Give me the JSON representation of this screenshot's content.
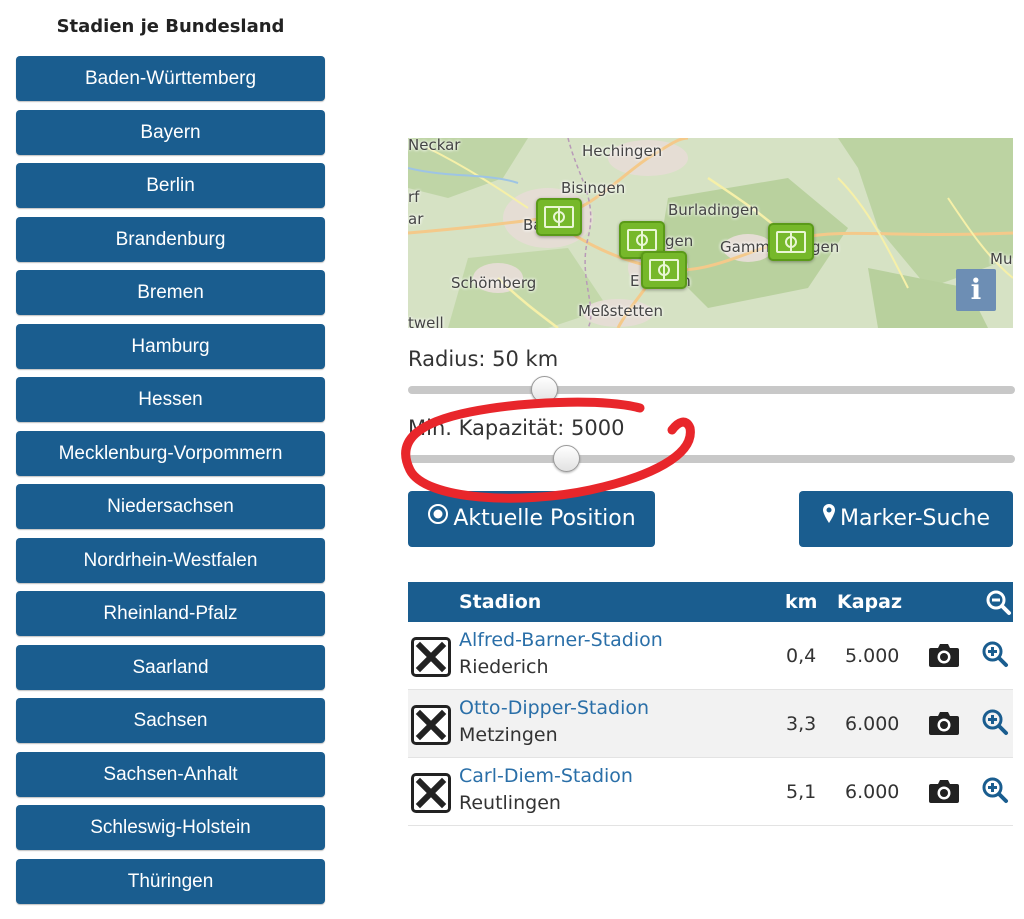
{
  "sidebar": {
    "title": "Stadien je Bundesland",
    "states": [
      "Baden-Württemberg",
      "Bayern",
      "Berlin",
      "Brandenburg",
      "Bremen",
      "Hamburg",
      "Hessen",
      "Mecklenburg-Vorpommern",
      "Niedersachsen",
      "Nordrhein-Westfalen",
      "Rheinland-Pfalz",
      "Saarland",
      "Sachsen",
      "Sachsen-Anhalt",
      "Schleswig-Holstein",
      "Thüringen"
    ]
  },
  "map": {
    "places": [
      "Neckar",
      "Hechingen",
      "Bisingen",
      "Burladingen",
      "Gamm",
      "gen",
      "Schömberg",
      "Meßstetten",
      "Bal",
      "gen",
      "E",
      "en",
      "twell",
      "rf",
      "ar",
      "Mu"
    ],
    "markers": 4,
    "info_label": "i"
  },
  "radius": {
    "label": "Radius: 50 km",
    "value_km": 50
  },
  "capacity": {
    "label": "Min. Kapazität: 5000",
    "value": 5000
  },
  "buttons": {
    "current_position": "Aktuelle Position",
    "marker_search": "Marker-Suche"
  },
  "table": {
    "headers": {
      "stadium": "Stadion",
      "km": "km",
      "capacity": "Kapaz"
    },
    "rows": [
      {
        "name": "Alfred-Barner-Stadion",
        "city": "Riederich",
        "km": "0,4",
        "capacity": "5.000"
      },
      {
        "name": "Otto-Dipper-Stadion",
        "city": "Metzingen",
        "km": "3,3",
        "capacity": "6.000"
      },
      {
        "name": "Carl-Diem-Stadion",
        "city": "Reutlingen",
        "km": "5,1",
        "capacity": "6.000"
      }
    ]
  },
  "colors": {
    "primary": "#1a5d8f",
    "link": "#2a6fa8",
    "marker": "#76b82a",
    "annotation": "#e8262b"
  },
  "icons": [
    "target-icon",
    "map-pin-icon",
    "zoom-out-icon",
    "close-box-icon",
    "camera-icon",
    "zoom-in-icon",
    "info-icon"
  ]
}
